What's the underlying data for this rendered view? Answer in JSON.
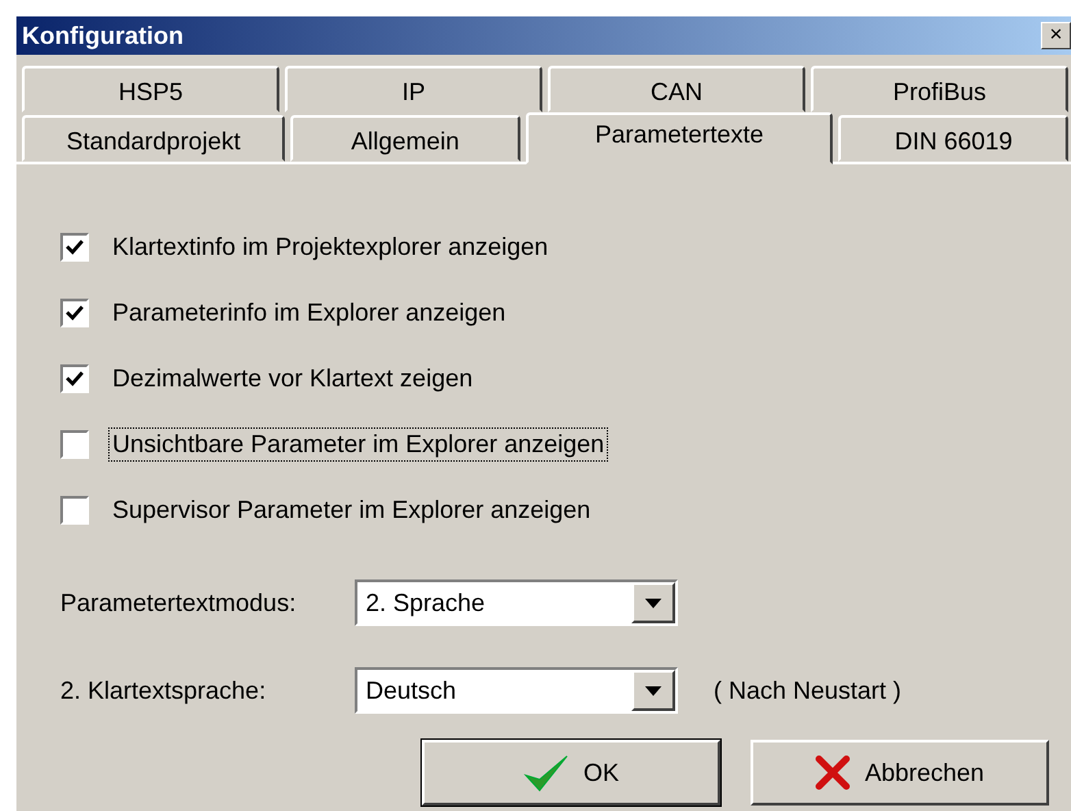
{
  "window": {
    "title": "Konfiguration",
    "close": "×"
  },
  "tab_rows": [
    [
      {
        "label": "HSP5",
        "selected": false
      },
      {
        "label": "IP",
        "selected": false
      },
      {
        "label": "CAN",
        "selected": false
      },
      {
        "label": "ProfiBus",
        "selected": false
      }
    ],
    [
      {
        "label": "Standardprojekt",
        "selected": false
      },
      {
        "label": "Allgemein",
        "selected": false
      },
      {
        "label": "Parametertexte",
        "selected": true
      },
      {
        "label": "DIN 66019",
        "selected": false
      }
    ]
  ],
  "options": [
    {
      "label": "Klartextinfo im Projektexplorer anzeigen",
      "checked": true,
      "focused": false
    },
    {
      "label": "Parameterinfo im Explorer anzeigen",
      "checked": true,
      "focused": false
    },
    {
      "label": "Dezimalwerte vor Klartext zeigen",
      "checked": true,
      "focused": false
    },
    {
      "label": "Unsichtbare Parameter im Explorer anzeigen",
      "checked": false,
      "focused": true
    },
    {
      "label": "Supervisor Parameter im Explorer anzeigen",
      "checked": false,
      "focused": false
    }
  ],
  "fields": [
    {
      "label": "Parametertextmodus:",
      "value": "2. Sprache"
    },
    {
      "label": "2. Klartextsprache:",
      "value": "Deutsch",
      "note": "( Nach Neustart )"
    }
  ],
  "buttons": [
    {
      "kind": "ok",
      "label": "OK"
    },
    {
      "kind": "cancel",
      "label": "Abbrechen"
    }
  ]
}
